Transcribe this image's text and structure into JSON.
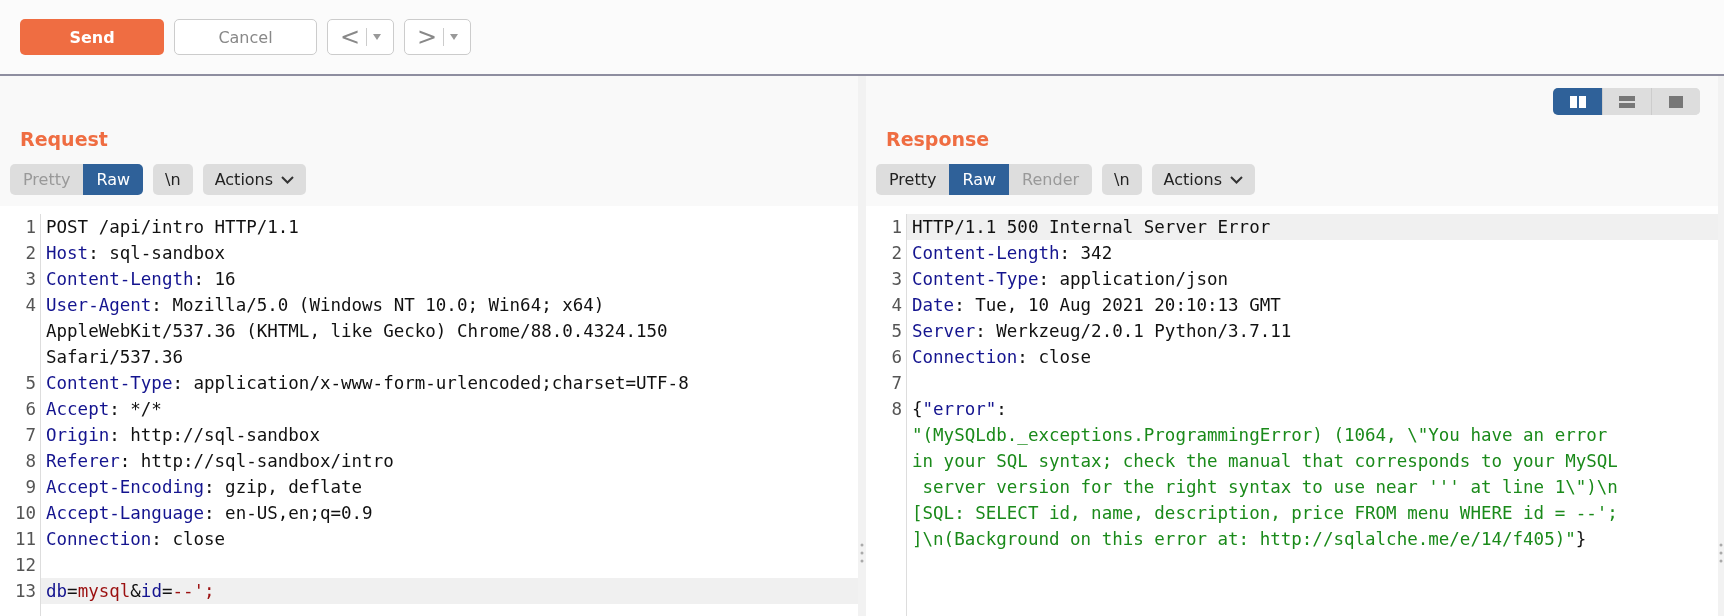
{
  "toolbar": {
    "send": "Send",
    "cancel": "Cancel",
    "back": "<",
    "forward": ">"
  },
  "layout_buttons": [
    {
      "kind": "columns",
      "selected": true
    },
    {
      "kind": "rows",
      "selected": false
    },
    {
      "kind": "single",
      "selected": false
    }
  ],
  "panels": [
    {
      "title": "Request",
      "tabs": [
        {
          "label": "Pretty",
          "selected": false,
          "disabled": true
        },
        {
          "label": "Raw",
          "selected": true,
          "disabled": false
        }
      ],
      "newline_button": "\\n",
      "actions_button": "Actions",
      "lines": [
        {
          "number": "1",
          "highlighted": false,
          "wraps": [
            {
              "parts": [
                {
                  "kind": "plain",
                  "text": "POST /api/intro HTTP/1.1"
                }
              ]
            }
          ]
        },
        {
          "number": "2",
          "highlighted": false,
          "wraps": [
            {
              "parts": [
                {
                  "kind": "key",
                  "text": "Host"
                },
                {
                  "kind": "plain",
                  "text": ": sql-sandbox"
                }
              ]
            }
          ]
        },
        {
          "number": "3",
          "highlighted": false,
          "wraps": [
            {
              "parts": [
                {
                  "kind": "key",
                  "text": "Content-Length"
                },
                {
                  "kind": "plain",
                  "text": ": 16"
                }
              ]
            }
          ]
        },
        {
          "number": "4",
          "highlighted": false,
          "wraps": [
            {
              "parts": [
                {
                  "kind": "key",
                  "text": "User-Agent"
                },
                {
                  "kind": "plain",
                  "text": ": Mozilla/5.0 (Windows NT 10.0; Win64; x64)"
                }
              ]
            },
            {
              "parts": [
                {
                  "kind": "plain",
                  "text": "AppleWebKit/537.36 (KHTML, like Gecko) Chrome/88.0.4324.150"
                }
              ]
            },
            {
              "parts": [
                {
                  "kind": "plain",
                  "text": "Safari/537.36"
                }
              ]
            }
          ]
        },
        {
          "number": "5",
          "highlighted": false,
          "wraps": [
            {
              "parts": [
                {
                  "kind": "key",
                  "text": "Content-Type"
                },
                {
                  "kind": "plain",
                  "text": ": application/x-www-form-urlencoded;charset=UTF-8"
                }
              ]
            }
          ]
        },
        {
          "number": "6",
          "highlighted": false,
          "wraps": [
            {
              "parts": [
                {
                  "kind": "key",
                  "text": "Accept"
                },
                {
                  "kind": "plain",
                  "text": ": */*"
                }
              ]
            }
          ]
        },
        {
          "number": "7",
          "highlighted": false,
          "wraps": [
            {
              "parts": [
                {
                  "kind": "key",
                  "text": "Origin"
                },
                {
                  "kind": "plain",
                  "text": ": http://sql-sandbox"
                }
              ]
            }
          ]
        },
        {
          "number": "8",
          "highlighted": false,
          "wraps": [
            {
              "parts": [
                {
                  "kind": "key",
                  "text": "Referer"
                },
                {
                  "kind": "plain",
                  "text": ": http://sql-sandbox/intro"
                }
              ]
            }
          ]
        },
        {
          "number": "9",
          "highlighted": false,
          "wraps": [
            {
              "parts": [
                {
                  "kind": "key",
                  "text": "Accept-Encoding"
                },
                {
                  "kind": "plain",
                  "text": ": gzip, deflate"
                }
              ]
            }
          ]
        },
        {
          "number": "10",
          "highlighted": false,
          "wraps": [
            {
              "parts": [
                {
                  "kind": "key",
                  "text": "Accept-Language"
                },
                {
                  "kind": "plain",
                  "text": ": en-US,en;q=0.9"
                }
              ]
            }
          ]
        },
        {
          "number": "11",
          "highlighted": false,
          "wraps": [
            {
              "parts": [
                {
                  "kind": "key",
                  "text": "Connection"
                },
                {
                  "kind": "plain",
                  "text": ": close"
                }
              ]
            }
          ]
        },
        {
          "number": "12",
          "highlighted": false
        },
        {
          "number": "13",
          "highlighted": true,
          "wraps": [
            {
              "parts": [
                {
                  "kind": "key",
                  "text": "db"
                },
                {
                  "kind": "plain",
                  "text": "="
                },
                {
                  "kind": "value",
                  "text": "mysql"
                },
                {
                  "kind": "plain",
                  "text": "&"
                },
                {
                  "kind": "key",
                  "text": "id"
                },
                {
                  "kind": "plain",
                  "text": "="
                },
                {
                  "kind": "value",
                  "text": "--';"
                }
              ]
            }
          ]
        }
      ]
    },
    {
      "title": "Response",
      "tabs": [
        {
          "label": "Pretty",
          "selected": false,
          "disabled": false
        },
        {
          "label": "Raw",
          "selected": true,
          "disabled": false
        },
        {
          "label": "Render",
          "selected": false,
          "disabled": true
        }
      ],
      "newline_button": "\\n",
      "actions_button": "Actions",
      "lines": [
        {
          "number": "1",
          "highlighted": true,
          "wraps": [
            {
              "parts": [
                {
                  "kind": "plain",
                  "text": "HTTP/1.1 500 Internal Server Error"
                }
              ]
            }
          ]
        },
        {
          "number": "2",
          "highlighted": false,
          "wraps": [
            {
              "parts": [
                {
                  "kind": "key",
                  "text": "Content-Length"
                },
                {
                  "kind": "plain",
                  "text": ": 342"
                }
              ]
            }
          ]
        },
        {
          "number": "3",
          "highlighted": false,
          "wraps": [
            {
              "parts": [
                {
                  "kind": "key",
                  "text": "Content-Type"
                },
                {
                  "kind": "plain",
                  "text": ": application/json"
                }
              ]
            }
          ]
        },
        {
          "number": "4",
          "highlighted": false,
          "wraps": [
            {
              "parts": [
                {
                  "kind": "key",
                  "text": "Date"
                },
                {
                  "kind": "plain",
                  "text": ": Tue, 10 Aug 2021 20:10:13 GMT"
                }
              ]
            }
          ]
        },
        {
          "number": "5",
          "highlighted": false,
          "wraps": [
            {
              "parts": [
                {
                  "kind": "key",
                  "text": "Server"
                },
                {
                  "kind": "plain",
                  "text": ": Werkzeug/2.0.1 Python/3.7.11"
                }
              ]
            }
          ]
        },
        {
          "number": "6",
          "highlighted": false,
          "wraps": [
            {
              "parts": [
                {
                  "kind": "key",
                  "text": "Connection"
                },
                {
                  "kind": "plain",
                  "text": ": close"
                }
              ]
            }
          ]
        },
        {
          "number": "7",
          "highlighted": false
        },
        {
          "number": "8",
          "highlighted": false,
          "wraps": [
            {
              "parts": [
                {
                  "kind": "plain",
                  "text": "{"
                },
                {
                  "kind": "key",
                  "text": "\"error\""
                },
                {
                  "kind": "plain",
                  "text": ":"
                }
              ]
            },
            {
              "parts": [
                {
                  "kind": "string",
                  "text": "\"(MySQLdb._exceptions.ProgrammingError) (1064, \\\"You have an error"
                }
              ]
            },
            {
              "parts": [
                {
                  "kind": "string",
                  "text": "in your SQL syntax; check the manual that corresponds to your MySQL"
                }
              ]
            },
            {
              "parts": [
                {
                  "kind": "string",
                  "text": " server version for the right syntax to use near ''' at line 1\\\")\\n"
                }
              ]
            },
            {
              "parts": [
                {
                  "kind": "string",
                  "text": "[SQL: SELECT id, name, description, price FROM menu WHERE id = --';"
                }
              ]
            },
            {
              "parts": [
                {
                  "kind": "string",
                  "text": "]\\n(Background on this error at: http://sqlalche.me/e/14/f405)\""
                },
                {
                  "kind": "plain",
                  "text": "}"
                }
              ]
            }
          ]
        }
      ]
    }
  ]
}
